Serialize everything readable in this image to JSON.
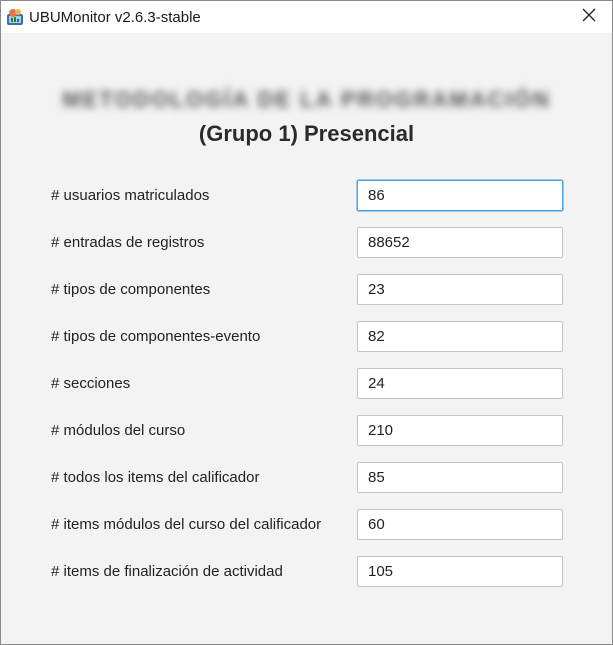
{
  "window": {
    "title": "UBUMonitor v2.6.3-stable",
    "close_icon": "close-icon",
    "app_icon": "ubumonitor-app-icon"
  },
  "course": {
    "name": "METODOLOGÍA DE LA PROGRAMACIÓN",
    "group": "(Grupo 1) Presencial"
  },
  "stats": [
    {
      "label": "# usuarios matriculados",
      "value": "86"
    },
    {
      "label": "# entradas de registros",
      "value": "88652"
    },
    {
      "label": "# tipos de componentes",
      "value": "23"
    },
    {
      "label": "# tipos de componentes-evento",
      "value": "82"
    },
    {
      "label": "# secciones",
      "value": "24"
    },
    {
      "label": "# módulos del curso",
      "value": "210"
    },
    {
      "label": "# todos los items del calificador",
      "value": "85"
    },
    {
      "label": "# items módulos del curso del calificador",
      "value": "60"
    },
    {
      "label": "# items de finalización de actividad",
      "value": "105"
    }
  ],
  "colors": {
    "focus_border": "#4a9de2",
    "background": "#f3f3f3"
  }
}
